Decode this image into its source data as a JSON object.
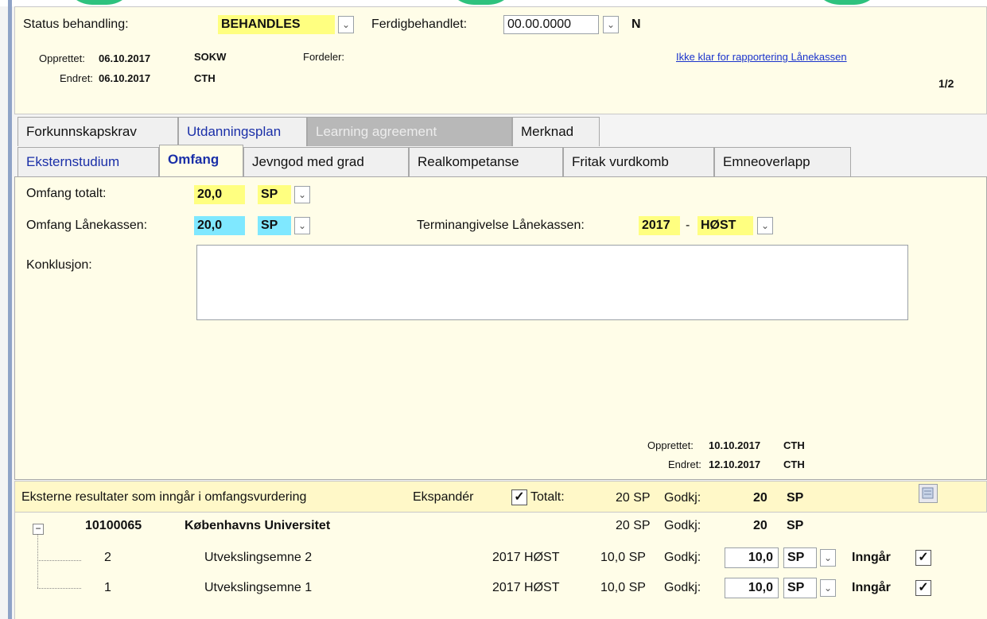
{
  "status": {
    "label": "Status behandling:",
    "value": "BEHANDLES",
    "ferdig_label": "Ferdigbehandlet:",
    "ferdig_value": "00.00.0000",
    "flag": "N"
  },
  "meta": {
    "opprettet_label": "Opprettet:",
    "opprettet_date": "06.10.2017",
    "opprettet_user": "SOKW",
    "endret_label": "Endret:",
    "endret_date": "06.10.2017",
    "endret_user": "CTH",
    "fordeler_label": "Fordeler:",
    "rapport_link": "Ikke klar for rapportering Lånekassen",
    "page_indicator": "1/2"
  },
  "tabs_row1": [
    "Forkunnskapskrav",
    "Utdanningsplan",
    "Learning agreement",
    "Merknad"
  ],
  "tabs_row2": [
    "Eksternstudium",
    "Omfang",
    "Jevngod med grad",
    "Realkompetanse",
    "Fritak vurdkomb",
    "Emneoverlapp"
  ],
  "omfang": {
    "totalt_label": "Omfang totalt:",
    "totalt_value": "20,0",
    "totalt_unit": "SP",
    "lanekassen_label": "Omfang Lånekassen:",
    "lanekassen_value": "20,0",
    "lanekassen_unit": "SP",
    "termin_label": "Terminangivelse Lånekassen:",
    "termin_year": "2017",
    "termin_sep": "-",
    "termin_season": "HØST",
    "konklusjon_label": "Konklusjon:",
    "konklusjon_value": "",
    "opprettet_label": "Opprettet:",
    "opprettet_date": "10.10.2017",
    "opprettet_user": "CTH",
    "endret_label": "Endret:",
    "endret_date": "12.10.2017",
    "endret_user": "CTH"
  },
  "results": {
    "header_label": "Eksterne resultater som inngår i omfangsvurdering",
    "ekspander_label": "Ekspandér",
    "totalt_label": "Totalt:",
    "totalt_sp": "20 SP",
    "godkj_label": "Godkj:",
    "godkj_value": "20",
    "godkj_unit": "SP",
    "institution": {
      "code": "10100065",
      "name": "Københavns Universitet",
      "sp": "20 SP",
      "godkj_label": "Godkj:",
      "godkj_value": "20",
      "godkj_unit": "SP"
    },
    "rows": [
      {
        "nr": "2",
        "name": "Utvekslingsemne 2",
        "term": "2017 HØST",
        "sp": "10,0 SP",
        "godkj_label": "Godkj:",
        "godkj_value": "10,0",
        "unit": "SP",
        "inngar_label": "Inngår"
      },
      {
        "nr": "1",
        "name": "Utvekslingsemne 1",
        "term": "2017 HØST",
        "sp": "10,0 SP",
        "godkj_label": "Godkj:",
        "godkj_value": "10,0",
        "unit": "SP",
        "inngar_label": "Inngår"
      }
    ]
  }
}
